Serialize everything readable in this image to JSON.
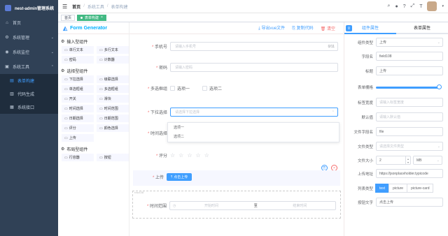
{
  "app": {
    "title": "nest-admin管理系统"
  },
  "sidebar": {
    "items": [
      {
        "label": "首页",
        "icon": "home-icon"
      },
      {
        "label": "系统管理",
        "icon": "gear-icon"
      },
      {
        "label": "系统监控",
        "icon": "monitor-icon"
      },
      {
        "label": "系统工具",
        "icon": "tool-icon"
      }
    ],
    "sub": [
      {
        "label": "表单构建"
      },
      {
        "label": "代码生成"
      },
      {
        "label": "系统接口"
      }
    ]
  },
  "header": {
    "crumbs": [
      "首页",
      "系统工具",
      "表单构建"
    ]
  },
  "tags": {
    "home": "首页",
    "active": "表单构建"
  },
  "left": {
    "title": "Form Generator",
    "groups": [
      {
        "title": "输入型组件",
        "items": [
          "单行文本",
          "多行文本",
          "密码",
          "计数器"
        ]
      },
      {
        "title": "选择型组件",
        "items": [
          "下拉选择",
          "级联选择",
          "单选框组",
          "多选框组",
          "开关",
          "滑块",
          "时间选择",
          "时间范围",
          "日期选择",
          "日期范围",
          "评分",
          "颜色选择",
          "上传"
        ]
      },
      {
        "title": "布局型组件",
        "items": [
          "行容器",
          "按钮"
        ]
      }
    ]
  },
  "center": {
    "actions": {
      "export": "导出vue文件",
      "copy": "复制代码",
      "clear": "清空"
    },
    "phone": {
      "label": "手机号",
      "placeholder": "请输入手机号",
      "count": "0/11"
    },
    "password": {
      "label": "密码",
      "placeholder": "请输入密码"
    },
    "checkbox": {
      "label": "多选框组",
      "opt1": "选项一",
      "opt2": "选项二"
    },
    "select": {
      "label": "下拉选择",
      "placeholder": "请选择下拉选择",
      "opts": [
        "选项一",
        "选项二"
      ]
    },
    "time": {
      "label": "时间选择"
    },
    "rate": {
      "label": "评分"
    },
    "upload": {
      "label": "上传",
      "button": "点击上传"
    },
    "row": {
      "tag": "row108"
    },
    "range": {
      "label": "时间范围",
      "start": "开始时间",
      "to": "至",
      "end": "结束时间"
    }
  },
  "right": {
    "tabs": [
      "组件属性",
      "表单属性"
    ],
    "rows": [
      {
        "label": "组件类型",
        "value": "上传"
      },
      {
        "label": "字段名",
        "value": "field108"
      },
      {
        "label": "标题",
        "value": "上传"
      },
      {
        "label": "表单栅格"
      },
      {
        "label": "标签宽度",
        "value": "请输入标签宽度"
      },
      {
        "label": "默认值",
        "value": "请输入默认值"
      },
      {
        "label": "文件字段名",
        "value": "file"
      },
      {
        "label": "文件类型",
        "value": "请选择文件类型"
      },
      {
        "label": "文件大小",
        "value": "2",
        "unit": "MB"
      },
      {
        "label": "上传地址",
        "value": "https://jsonplaceholder.typicode"
      },
      {
        "label": "列表类型",
        "opts": [
          "text",
          "picture",
          "picture-card"
        ]
      },
      {
        "label": "按钮文字",
        "value": "点击上传"
      }
    ],
    "span_value": 24,
    "span_max": 24
  }
}
